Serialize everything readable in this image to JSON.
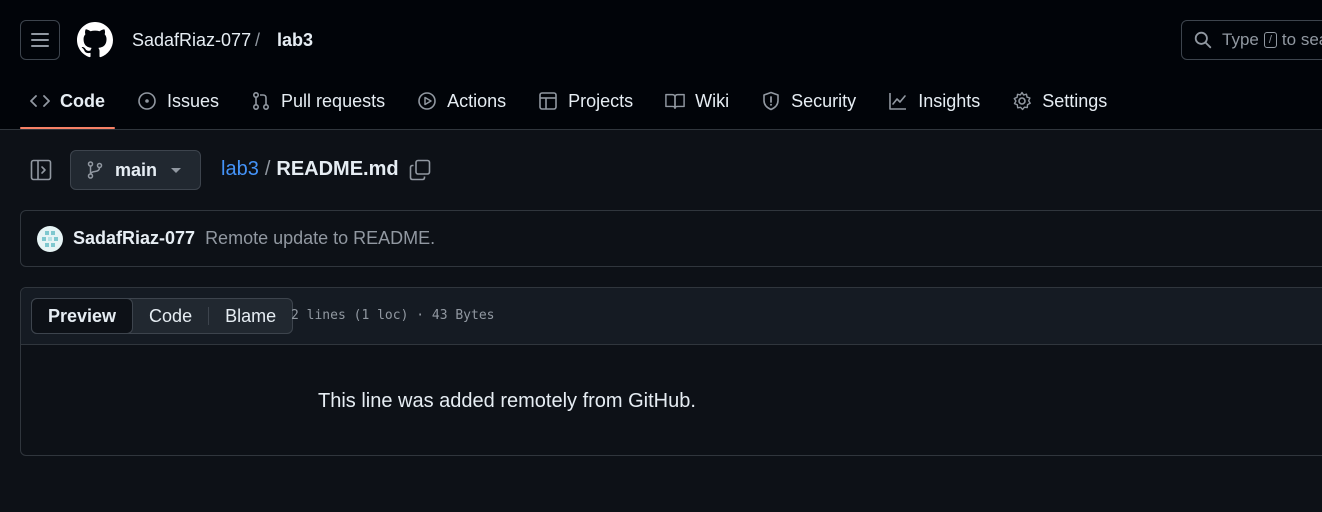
{
  "header": {
    "owner": "SadafRiaz-077",
    "separator": "/",
    "repo": "lab3",
    "search": {
      "prefix": "Type",
      "key": "/",
      "suffix": "to search"
    }
  },
  "nav": {
    "tabs": [
      {
        "label": "Code",
        "icon": "code-icon",
        "active": true
      },
      {
        "label": "Issues",
        "icon": "issue-icon"
      },
      {
        "label": "Pull requests",
        "icon": "pull-request-icon"
      },
      {
        "label": "Actions",
        "icon": "play-icon"
      },
      {
        "label": "Projects",
        "icon": "table-icon"
      },
      {
        "label": "Wiki",
        "icon": "book-icon"
      },
      {
        "label": "Security",
        "icon": "shield-icon"
      },
      {
        "label": "Insights",
        "icon": "graph-icon"
      },
      {
        "label": "Settings",
        "icon": "gear-icon"
      }
    ]
  },
  "toolbar": {
    "branch": "main",
    "path_repo": "lab3",
    "path_sep": "/",
    "file": "README.md"
  },
  "commit": {
    "author": "SadafRiaz-077",
    "message": "Remote update to README."
  },
  "file_view": {
    "tabs": [
      "Preview",
      "Code",
      "Blame"
    ],
    "meta": "2 lines (1 loc) · 43 Bytes",
    "content": "This line was added remotely from GitHub."
  },
  "colors": {
    "accent_underline": "#f78166",
    "link": "#4493f8",
    "background": "#0d1117",
    "header_bg": "#010409"
  }
}
